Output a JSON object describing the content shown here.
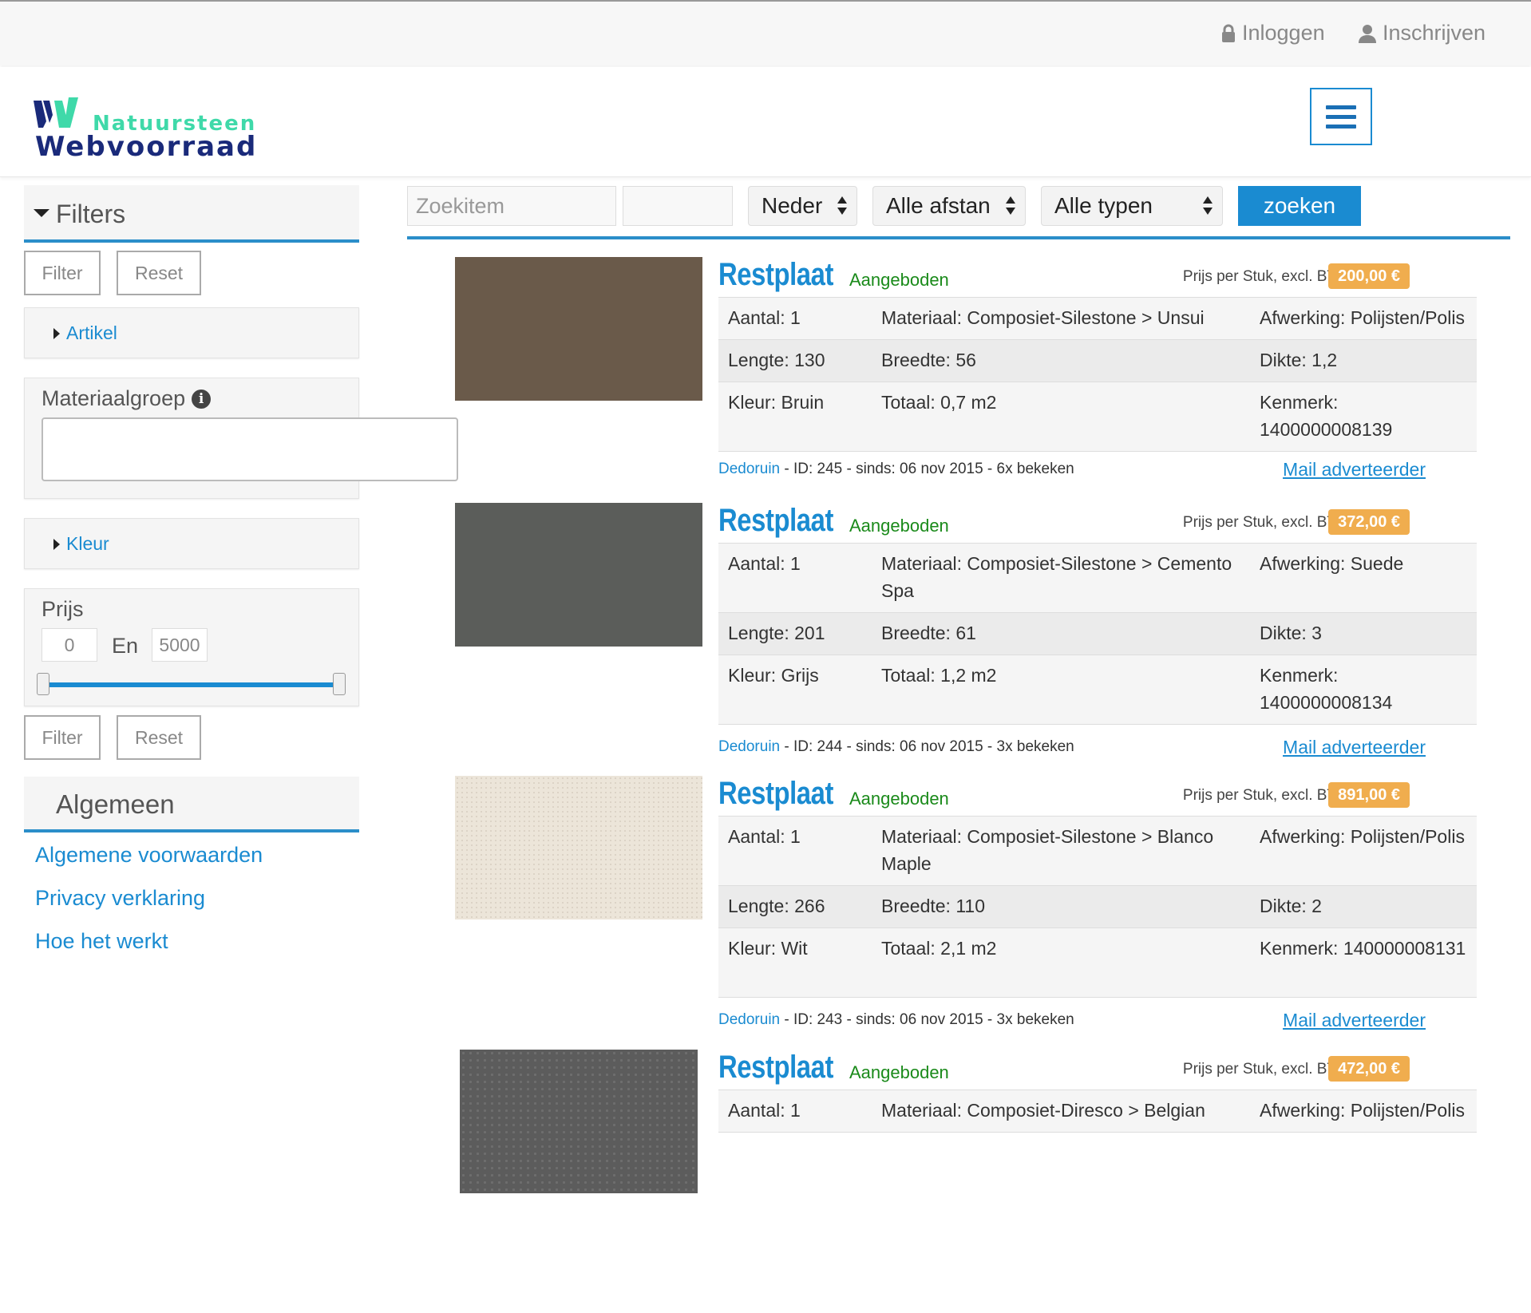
{
  "topbar": {
    "login": "Inloggen",
    "register": "Inschrijven"
  },
  "brand": {
    "line1": "Natuursteen",
    "line2": "Webvoorraad"
  },
  "sidebar": {
    "filters_title": "Filters",
    "filter_btn": "Filter",
    "reset_btn": "Reset",
    "artikel": "Artikel",
    "materiaalgroep": "Materiaalgroep",
    "kleur": "Kleur",
    "prijs": "Prijs",
    "price_min": "0",
    "price_sep": "En",
    "price_max": "5000",
    "algemeen_title": "Algemeen",
    "links": [
      "Algemene voorwaarden",
      "Privacy verklaring",
      "Hoe het werkt"
    ]
  },
  "search": {
    "placeholder": "Zoekitem",
    "postcode": "",
    "country": "Neder",
    "distance": "Alle afstan",
    "type": "Alle typen",
    "button": "zoeken"
  },
  "listings": [
    {
      "title": "Restplaat",
      "status": "Aangeboden",
      "price_label": "Prijs per Stuk, excl. BTW",
      "price": "200,00 €",
      "thumb_color": "#6a5a4a",
      "rows": [
        [
          "Aantal: 1",
          "Materiaal: Composiet-Silestone > Unsui",
          "Afwerking: Polijsten/Polis"
        ],
        [
          "Lengte: 130",
          "Breedte: 56",
          "Dikte: 1,2"
        ],
        [
          "Kleur: Bruin",
          "Totaal: 0,7 m2",
          "Kenmerk: 1400000008139"
        ]
      ],
      "seller": "Dedoruin",
      "meta": " - ID: 245 - sinds: 06 nov 2015 - 6x bekeken",
      "mail": "Mail adverteerder"
    },
    {
      "title": "Restplaat",
      "status": "Aangeboden",
      "price_label": "Prijs per Stuk, excl. BTW",
      "price": "372,00 €",
      "thumb_color": "#5b5d5a",
      "rows": [
        [
          "Aantal: 1",
          "Materiaal: Composiet-Silestone > Cemento Spa",
          "Afwerking: Suede"
        ],
        [
          "Lengte: 201",
          "Breedte: 61",
          "Dikte: 3"
        ],
        [
          "Kleur: Grijs",
          "Totaal: 1,2 m2",
          "Kenmerk: 1400000008134"
        ]
      ],
      "seller": "Dedoruin",
      "meta": " - ID: 244 - sinds: 06 nov 2015 - 3x bekeken",
      "mail": "Mail adverteerder"
    },
    {
      "title": "Restplaat",
      "status": "Aangeboden",
      "price_label": "Prijs per Stuk, excl. BTW",
      "price": "891,00 €",
      "thumb_color": "#ece5d9",
      "rows": [
        [
          "Aantal: 1",
          "Materiaal: Composiet-Silestone > Blanco Maple",
          "Afwerking: Polijsten/Polis"
        ],
        [
          "Lengte: 266",
          "Breedte: 110",
          "Dikte: 2"
        ],
        [
          "Kleur: Wit",
          "Totaal: 2,1 m2",
          "Kenmerk: 140000008131"
        ]
      ],
      "seller": "Dedoruin",
      "meta": " - ID: 243 - sinds: 06 nov 2015 - 3x bekeken",
      "mail": "Mail adverteerder"
    },
    {
      "title": "Restplaat",
      "status": "Aangeboden",
      "price_label": "Prijs per Stuk, excl. BTW",
      "price": "472,00 €",
      "thumb_color": "#5c5c5c",
      "rows": [
        [
          "Aantal: 1",
          "Materiaal: Composiet-Diresco > Belgian",
          "Afwerking: Polijsten/Polis"
        ]
      ],
      "seller": "",
      "meta": "",
      "mail": ""
    }
  ]
}
